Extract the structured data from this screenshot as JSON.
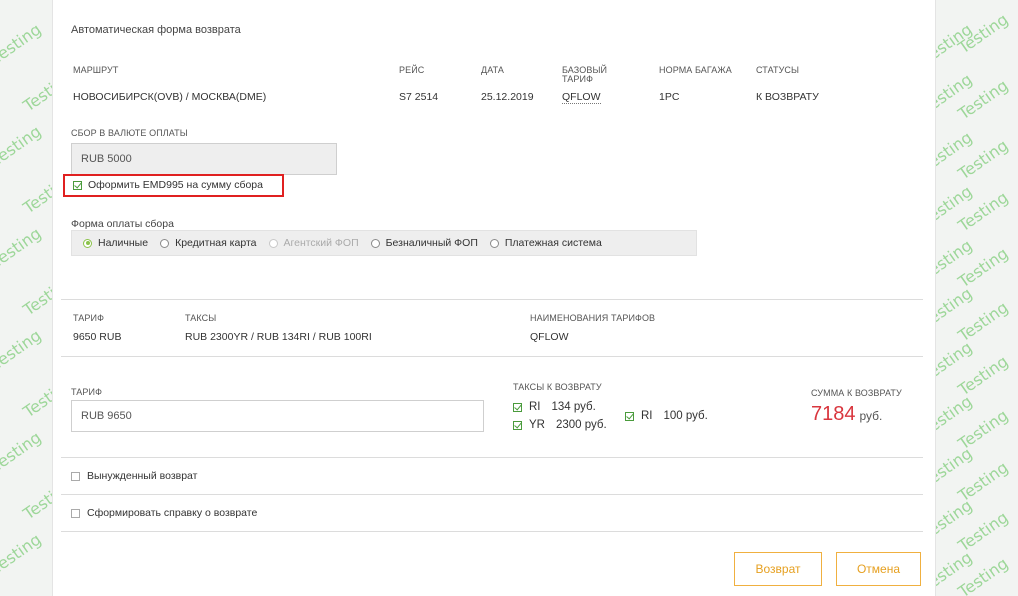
{
  "form": {
    "title": "Автоматическая форма возврата",
    "route": {
      "headers": {
        "route": "МАРШРУТ",
        "flight": "РЕЙС",
        "date": "ДАТА",
        "base_fare": "БАЗОВЫЙ ТАРИФ",
        "baggage": "НОРМА БАГАЖА",
        "status": "СТАТУСЫ"
      },
      "row": {
        "route": "НОВОСИБИРСК(OVB) / МОСКВА(DME)",
        "flight": "S7 2514",
        "date": "25.12.2019",
        "base_fare": "QFLOW",
        "baggage": "1PC",
        "status": "К ВОЗВРАТУ"
      }
    },
    "fee": {
      "label": "СБОР В ВАЛЮТЕ ОПЛАТЫ",
      "value": "RUB 5000",
      "emd_checkbox_label": "Оформить EMD995 на сумму сбора",
      "emd_checked": true
    },
    "payment": {
      "label": "Форма оплаты сбора",
      "options": [
        {
          "label": "Наличные",
          "state": "selected"
        },
        {
          "label": "Кредитная карта",
          "state": "unselected"
        },
        {
          "label": "Агентский ФОП",
          "state": "disabled"
        },
        {
          "label": "Безналичный ФОП",
          "state": "unselected"
        },
        {
          "label": "Платежная система",
          "state": "unselected"
        }
      ]
    },
    "fare_summary": {
      "fare_label": "ТАРИФ",
      "fare_value": "9650 RUB",
      "taxes_label": "ТАКСЫ",
      "taxes_value": "RUB 2300YR / RUB 134RI / RUB 100RI",
      "names_label": "НАИМЕНОВАНИЯ ТАРИФОВ",
      "names_value": "QFLOW"
    },
    "refund": {
      "fare_label": "ТАРИФ",
      "fare_value": "RUB 9650",
      "taxes_label": "ТАКСЫ К ВОЗВРАТУ",
      "taxes": [
        {
          "code": "RI",
          "amount": "134 руб.",
          "checked": true
        },
        {
          "code": "YR",
          "amount": "2300 руб.",
          "checked": true
        },
        {
          "code": "RI",
          "amount": "100 руб.",
          "checked": true
        }
      ],
      "sum_label": "СУММА К ВОЗВРАТУ",
      "sum_value": "7184",
      "sum_currency": "руб."
    },
    "forced_refund_label": "Вынужденный возврат",
    "certificate_label": "Сформировать справку о возврате",
    "buttons": {
      "refund": "Возврат",
      "cancel": "Отмена"
    }
  },
  "watermark": {
    "text": "Testing",
    "color": "#8fd28a"
  },
  "colors": {
    "accent_green": "#4a9b3c",
    "sum_red": "#d9363e",
    "button_orange": "#e6a020",
    "highlight_red": "#e02020"
  }
}
